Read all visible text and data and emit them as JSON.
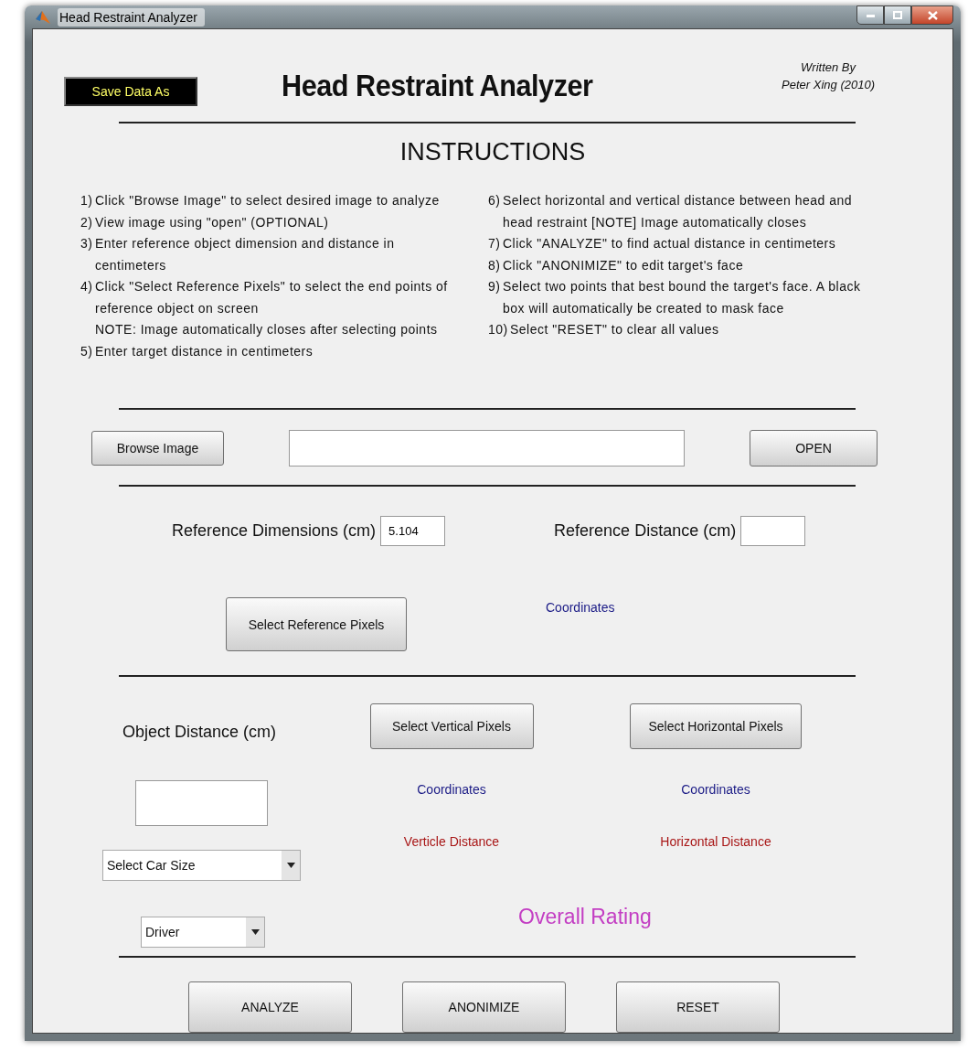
{
  "window": {
    "title": "Head Restraint Analyzer"
  },
  "save_button": {
    "label": "Save Data As"
  },
  "heading": "Head Restraint Analyzer",
  "author": [
    "Written By",
    "Peter Xing (2010)"
  ],
  "instructions": {
    "title": "INSTRUCTIONS",
    "left": [
      {
        "number": "1)",
        "text": "Click \"Browse Image\" to select desired image to analyze"
      },
      {
        "number": "2)",
        "text": "View image using \"open\" (OPTIONAL)"
      },
      {
        "number": "3)",
        "text": "Enter reference object dimension and distance in centimeters"
      },
      {
        "number": "4)",
        "text": "Click \"Select Reference Pixels\" to select the end points of reference object on screen",
        "note": "NOTE: Image automatically closes after selecting points"
      },
      {
        "number": "5)",
        "text": "Enter target distance in centimeters"
      }
    ],
    "right": [
      {
        "number": "6)",
        "text": "Select horizontal and vertical distance between head and head restraint [NOTE] Image automatically closes"
      },
      {
        "number": "7)",
        "text": "Click \"ANALYZE\" to find actual distance in centimeters"
      },
      {
        "number": "8)",
        "text": "Click \"ANONIMIZE\" to edit target's face"
      },
      {
        "number": "9)",
        "text": "Select two points that best bound the target's face. A black box will automatically be created to mask face"
      },
      {
        "number": "10)",
        "text": "Select \"RESET\" to clear all values"
      }
    ]
  },
  "browse": {
    "button": "Browse Image",
    "open_button": "OPEN"
  },
  "reference": {
    "dimensions_label": "Reference Dimensions (cm)",
    "dimensions_field": {
      "value": "5.104"
    },
    "distance_label": "Reference Distance (cm)",
    "select_button": "Select Reference Pixels",
    "coordinates": "Coordinates"
  },
  "target": {
    "object_distance_label": "Object Distance (cm)",
    "vertical": {
      "button": "Select Vertical Pixels",
      "coordinates": "Coordinates",
      "distance": "Verticle Distance"
    },
    "horizontal": {
      "button": "Select Horizontal Pixels",
      "coordinates": "Coordinates",
      "distance": "Horizontal Distance"
    },
    "car_size_dropdown": {
      "value": "Select Car Size"
    },
    "seat_dropdown": {
      "value": "Driver"
    },
    "overall_rating": "Overall Rating"
  },
  "actions": [
    "ANALYZE",
    "ANONIMIZE",
    "RESET"
  ]
}
